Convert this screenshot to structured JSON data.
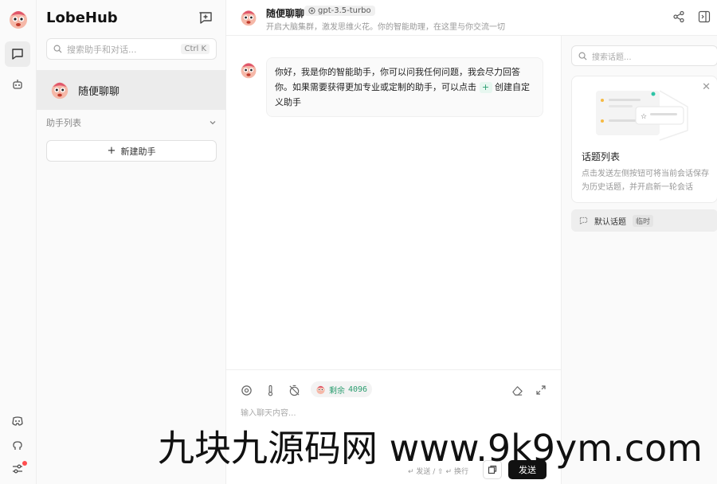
{
  "app": {
    "brand": "LobeHub"
  },
  "sidebar": {
    "search_placeholder": "搜索助手和对话...",
    "search_shortcut": "Ctrl K",
    "session_name": "随便聊聊",
    "group_label": "助手列表",
    "new_assistant_label": "新建助手"
  },
  "chat": {
    "title": "随便聊聊",
    "model": "gpt-3.5-turbo",
    "description": "开启大脑集群，激发思维火花。你的智能助理，在这里与你交流一切",
    "message_part1": "你好，我是你的智能助手，你可以问我任何问题，我会尽力回答你。如果需要获得更加专业或定制的助手，可以点击",
    "message_plus": "+",
    "message_part2": "创建自定义助手"
  },
  "composer": {
    "tokens_label": "剩余",
    "tokens_value": "4096",
    "input_placeholder": "输入聊天内容...",
    "hint": "↵ 发送 / ⇧ ↵ 换行",
    "send_label": "发送"
  },
  "topics": {
    "search_placeholder": "搜索话题...",
    "card_title": "话题列表",
    "card_text": "点击发送左侧按钮可将当前会话保存为历史话题，并开启新一轮会话",
    "default_topic": "默认话题",
    "default_tag": "临时"
  },
  "watermark": "九块九源码网 www.9k9ym.com",
  "colors": {
    "accent": "#2a9d6f",
    "send": "#111111",
    "badge": "#ff4d4f"
  }
}
